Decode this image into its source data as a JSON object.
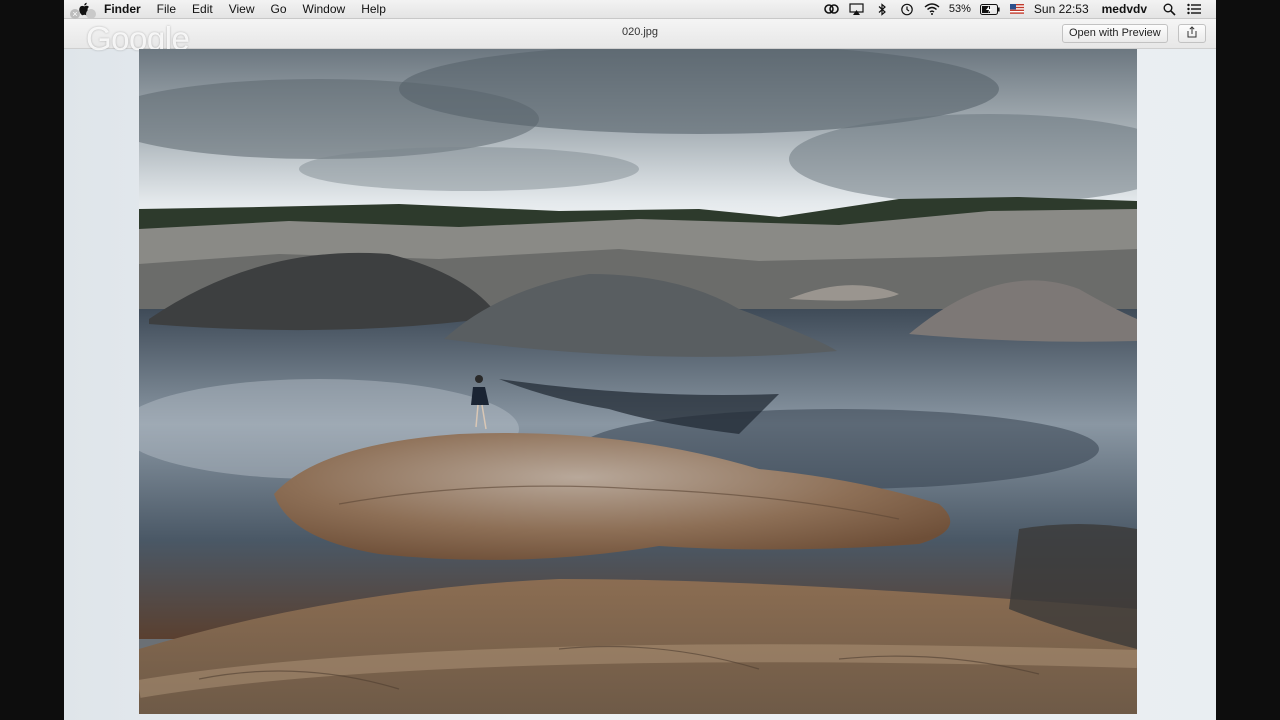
{
  "menubar": {
    "app_name": "Finder",
    "menus": [
      "File",
      "Edit",
      "View",
      "Go",
      "Window",
      "Help"
    ],
    "battery": "53%",
    "clock": "Sun 22:53",
    "user": "medvdv",
    "icons": [
      "creative-cloud-icon",
      "airplay-icon",
      "bluetooth-icon",
      "time-machine-icon",
      "wifi-icon",
      "battery-icon",
      "flag-us-icon",
      "spotlight-icon",
      "notification-center-icon"
    ]
  },
  "quicklook": {
    "title": "020.jpg",
    "open_with_label": "Open with Preview",
    "watermark": "Google"
  },
  "photo": {
    "description": ""
  }
}
